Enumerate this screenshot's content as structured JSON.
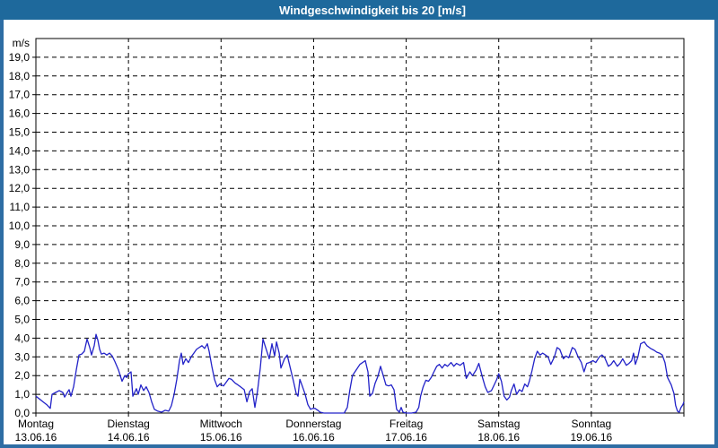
{
  "window": {
    "title": "Windgeschwindigkeit bis 20 [m/s]"
  },
  "colors": {
    "titlebar": "#1e699c",
    "window_border": "#2e6da4",
    "plot_background": "#ffffff",
    "plot_frame": "#000000",
    "gridline": "#000000",
    "series_line": "#2222c8",
    "title_text": "#ffffff",
    "axis_text": "#000000"
  },
  "chart_data": {
    "type": "line",
    "title": "Windgeschwindigkeit bis 20 [m/s]",
    "ylabel": "m/s",
    "xlabel": "",
    "y_min": 0,
    "y_max": 20,
    "y_tick_step": 1,
    "y_tick_labels": [
      "19,0",
      "18,0",
      "17,0",
      "16,0",
      "15,0",
      "14,0",
      "13,0",
      "12,0",
      "11,0",
      "10,0",
      "9,0",
      "8,0",
      "7,0",
      "6,0",
      "5,0",
      "4,0",
      "3,0",
      "2,0",
      "1,0",
      "0,0"
    ],
    "x_days": 7,
    "grid": "dashed",
    "legend": "none",
    "categories": [
      {
        "weekday": "Montag",
        "date": "13.06.16"
      },
      {
        "weekday": "Dienstag",
        "date": "14.06.16"
      },
      {
        "weekday": "Mittwoch",
        "date": "15.06.16"
      },
      {
        "weekday": "Donnerstag",
        "date": "16.06.16"
      },
      {
        "weekday": "Freitag",
        "date": "17.06.16"
      },
      {
        "weekday": "Samstag",
        "date": "18.06.16"
      },
      {
        "weekday": "Sonntag",
        "date": "19.06.16"
      }
    ],
    "series": [
      {
        "name": "Windgeschwindigkeit [m/s]",
        "points": [
          [
            0.0,
            0.9
          ],
          [
            0.039,
            0.75
          ],
          [
            0.078,
            0.6
          ],
          [
            0.116,
            0.45
          ],
          [
            0.155,
            0.25
          ],
          [
            0.175,
            1.0
          ],
          [
            0.213,
            1.1
          ],
          [
            0.252,
            1.2
          ],
          [
            0.291,
            1.1
          ],
          [
            0.31,
            0.85
          ],
          [
            0.339,
            1.1
          ],
          [
            0.359,
            1.25
          ],
          [
            0.378,
            0.9
          ],
          [
            0.407,
            1.4
          ],
          [
            0.436,
            2.3
          ],
          [
            0.465,
            3.1
          ],
          [
            0.494,
            3.15
          ],
          [
            0.524,
            3.3
          ],
          [
            0.553,
            3.95
          ],
          [
            0.582,
            3.5
          ],
          [
            0.601,
            3.1
          ],
          [
            0.63,
            3.6
          ],
          [
            0.65,
            4.2
          ],
          [
            0.669,
            3.9
          ],
          [
            0.688,
            3.4
          ],
          [
            0.708,
            3.15
          ],
          [
            0.737,
            3.2
          ],
          [
            0.766,
            3.1
          ],
          [
            0.795,
            3.2
          ],
          [
            0.824,
            3.05
          ],
          [
            0.853,
            2.75
          ],
          [
            0.892,
            2.3
          ],
          [
            0.931,
            1.7
          ],
          [
            0.96,
            2.0
          ],
          [
            0.979,
            1.9
          ],
          [
            1.0,
            2.1
          ],
          [
            1.028,
            2.2
          ],
          [
            1.047,
            0.9
          ],
          [
            1.086,
            1.3
          ],
          [
            1.105,
            1.0
          ],
          [
            1.134,
            1.5
          ],
          [
            1.163,
            1.2
          ],
          [
            1.192,
            1.4
          ],
          [
            1.222,
            1.1
          ],
          [
            1.251,
            0.6
          ],
          [
            1.28,
            0.2
          ],
          [
            1.318,
            0.1
          ],
          [
            1.357,
            0.05
          ],
          [
            1.396,
            0.15
          ],
          [
            1.435,
            0.1
          ],
          [
            1.464,
            0.4
          ],
          [
            1.493,
            1.0
          ],
          [
            1.522,
            1.8
          ],
          [
            1.551,
            2.8
          ],
          [
            1.571,
            3.2
          ],
          [
            1.59,
            2.6
          ],
          [
            1.619,
            2.9
          ],
          [
            1.648,
            2.7
          ],
          [
            1.677,
            3.0
          ],
          [
            1.706,
            3.2
          ],
          [
            1.735,
            3.4
          ],
          [
            1.764,
            3.5
          ],
          [
            1.794,
            3.6
          ],
          [
            1.823,
            3.45
          ],
          [
            1.852,
            3.7
          ],
          [
            1.871,
            3.3
          ],
          [
            1.9,
            2.5
          ],
          [
            1.929,
            1.8
          ],
          [
            1.958,
            1.4
          ],
          [
            1.987,
            1.55
          ],
          [
            2.026,
            1.45
          ],
          [
            2.056,
            1.65
          ],
          [
            2.085,
            1.85
          ],
          [
            2.114,
            1.8
          ],
          [
            2.152,
            1.6
          ],
          [
            2.182,
            1.5
          ],
          [
            2.211,
            1.4
          ],
          [
            2.25,
            1.25
          ],
          [
            2.279,
            0.6
          ],
          [
            2.308,
            1.15
          ],
          [
            2.337,
            1.3
          ],
          [
            2.366,
            0.3
          ],
          [
            2.395,
            1.2
          ],
          [
            2.424,
            2.4
          ],
          [
            2.453,
            3.95
          ],
          [
            2.482,
            3.5
          ],
          [
            2.521,
            2.9
          ],
          [
            2.55,
            3.7
          ],
          [
            2.579,
            3.05
          ],
          [
            2.599,
            3.8
          ],
          [
            2.628,
            3.2
          ],
          [
            2.647,
            2.4
          ],
          [
            2.686,
            2.9
          ],
          [
            2.715,
            3.1
          ],
          [
            2.744,
            2.5
          ],
          [
            2.783,
            1.7
          ],
          [
            2.812,
            1.05
          ],
          [
            2.831,
            0.9
          ],
          [
            2.851,
            1.8
          ],
          [
            2.88,
            1.4
          ],
          [
            2.909,
            1.0
          ],
          [
            2.938,
            0.45
          ],
          [
            2.967,
            0.2
          ],
          [
            2.99,
            0.25
          ],
          [
            3.015,
            0.25
          ],
          [
            3.045,
            0.15
          ],
          [
            3.07,
            0.05
          ],
          [
            3.11,
            0.0
          ],
          [
            3.18,
            0.0
          ],
          [
            3.25,
            0.0
          ],
          [
            3.33,
            0.0
          ],
          [
            3.364,
            0.3
          ],
          [
            3.39,
            1.2
          ],
          [
            3.42,
            2.0
          ],
          [
            3.46,
            2.3
          ],
          [
            3.5,
            2.6
          ],
          [
            3.558,
            2.8
          ],
          [
            3.587,
            2.2
          ],
          [
            3.607,
            0.9
          ],
          [
            3.636,
            1.05
          ],
          [
            3.665,
            1.6
          ],
          [
            3.694,
            1.95
          ],
          [
            3.723,
            2.5
          ],
          [
            3.752,
            2.0
          ],
          [
            3.781,
            1.5
          ],
          [
            3.81,
            1.45
          ],
          [
            3.839,
            1.5
          ],
          [
            3.868,
            1.25
          ],
          [
            3.897,
            0.2
          ],
          [
            3.926,
            0.05
          ],
          [
            3.946,
            0.3
          ],
          [
            3.965,
            0.05
          ],
          [
            4.0,
            0.0
          ],
          [
            4.058,
            0.0
          ],
          [
            4.107,
            0.05
          ],
          [
            4.136,
            0.3
          ],
          [
            4.155,
            0.9
          ],
          [
            4.184,
            1.4
          ],
          [
            4.213,
            1.75
          ],
          [
            4.242,
            1.7
          ],
          [
            4.271,
            1.9
          ],
          [
            4.3,
            2.2
          ],
          [
            4.33,
            2.5
          ],
          [
            4.359,
            2.6
          ],
          [
            4.388,
            2.4
          ],
          [
            4.417,
            2.6
          ],
          [
            4.446,
            2.5
          ],
          [
            4.485,
            2.7
          ],
          [
            4.514,
            2.5
          ],
          [
            4.543,
            2.65
          ],
          [
            4.582,
            2.55
          ],
          [
            4.62,
            2.7
          ],
          [
            4.649,
            1.85
          ],
          [
            4.688,
            2.2
          ],
          [
            4.717,
            2.0
          ],
          [
            4.756,
            2.3
          ],
          [
            4.785,
            2.65
          ],
          [
            4.824,
            1.9
          ],
          [
            4.853,
            1.4
          ],
          [
            4.882,
            1.1
          ],
          [
            4.921,
            1.2
          ],
          [
            4.95,
            1.5
          ],
          [
            4.979,
            1.8
          ],
          [
            5.0,
            2.1
          ],
          [
            5.029,
            1.7
          ],
          [
            5.058,
            0.9
          ],
          [
            5.087,
            0.7
          ],
          [
            5.116,
            0.85
          ],
          [
            5.136,
            1.2
          ],
          [
            5.165,
            1.55
          ],
          [
            5.194,
            1.0
          ],
          [
            5.223,
            1.25
          ],
          [
            5.252,
            1.15
          ],
          [
            5.281,
            1.55
          ],
          [
            5.31,
            1.4
          ],
          [
            5.33,
            1.7
          ],
          [
            5.359,
            2.25
          ],
          [
            5.388,
            2.9
          ],
          [
            5.417,
            3.3
          ],
          [
            5.446,
            3.1
          ],
          [
            5.475,
            3.2
          ],
          [
            5.504,
            3.1
          ],
          [
            5.533,
            3.0
          ],
          [
            5.562,
            2.6
          ],
          [
            5.601,
            3.0
          ],
          [
            5.63,
            3.5
          ],
          [
            5.659,
            3.4
          ],
          [
            5.698,
            2.9
          ],
          [
            5.727,
            3.05
          ],
          [
            5.756,
            2.95
          ],
          [
            5.795,
            3.5
          ],
          [
            5.824,
            3.4
          ],
          [
            5.853,
            3.05
          ],
          [
            5.892,
            2.7
          ],
          [
            5.921,
            2.2
          ],
          [
            5.95,
            2.65
          ],
          [
            5.979,
            2.7
          ],
          [
            6.019,
            2.8
          ],
          [
            6.048,
            2.7
          ],
          [
            6.087,
            3.0
          ],
          [
            6.116,
            3.1
          ],
          [
            6.145,
            2.95
          ],
          [
            6.184,
            2.5
          ],
          [
            6.213,
            2.6
          ],
          [
            6.242,
            2.8
          ],
          [
            6.281,
            2.5
          ],
          [
            6.31,
            2.65
          ],
          [
            6.339,
            2.9
          ],
          [
            6.378,
            2.55
          ],
          [
            6.407,
            2.65
          ],
          [
            6.436,
            2.8
          ],
          [
            6.456,
            3.2
          ],
          [
            6.475,
            2.6
          ],
          [
            6.504,
            3.0
          ],
          [
            6.533,
            3.7
          ],
          [
            6.572,
            3.8
          ],
          [
            6.601,
            3.6
          ],
          [
            6.64,
            3.45
          ],
          [
            6.679,
            3.35
          ],
          [
            6.708,
            3.25
          ],
          [
            6.737,
            3.2
          ],
          [
            6.766,
            3.1
          ],
          [
            6.795,
            2.7
          ],
          [
            6.824,
            1.9
          ],
          [
            6.863,
            1.5
          ],
          [
            6.892,
            1.05
          ],
          [
            6.911,
            0.4
          ],
          [
            6.931,
            0.1
          ],
          [
            6.95,
            0.05
          ],
          [
            6.969,
            0.3
          ],
          [
            6.989,
            0.45
          ],
          [
            7.0,
            0.6
          ]
        ]
      }
    ]
  }
}
